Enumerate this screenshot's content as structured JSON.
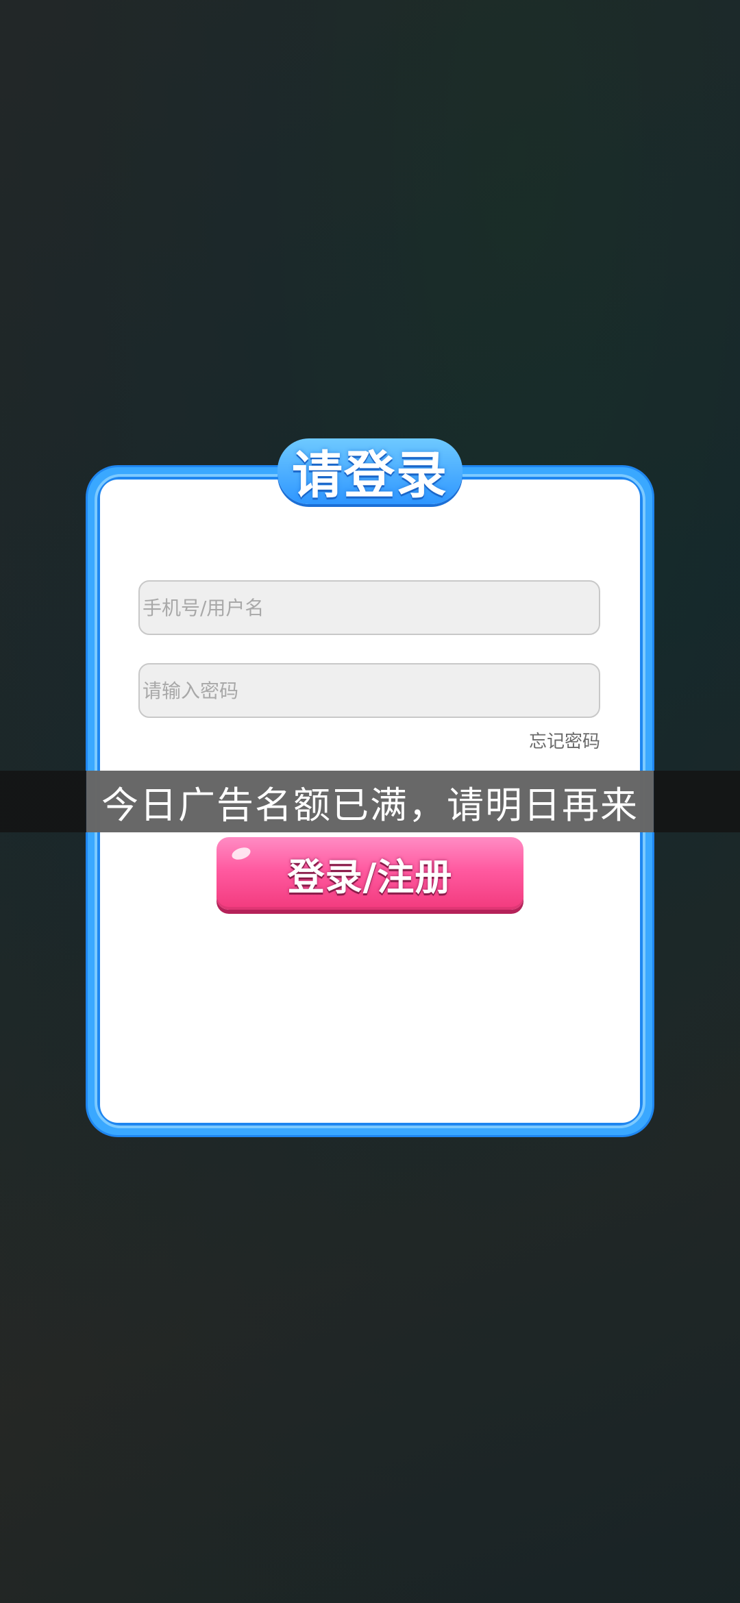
{
  "login_dialog": {
    "title": "请登录",
    "username_placeholder": "手机号/用户名",
    "password_placeholder": "请输入密码",
    "forgot_password": "忘记密码",
    "submit_label": "登录/注册"
  },
  "toast": {
    "message": "今日广告名额已满，请明日再来"
  },
  "colors": {
    "frame_blue": "#3aa8ff",
    "button_pink": "#ff5aa0",
    "input_bg": "#efefef"
  }
}
